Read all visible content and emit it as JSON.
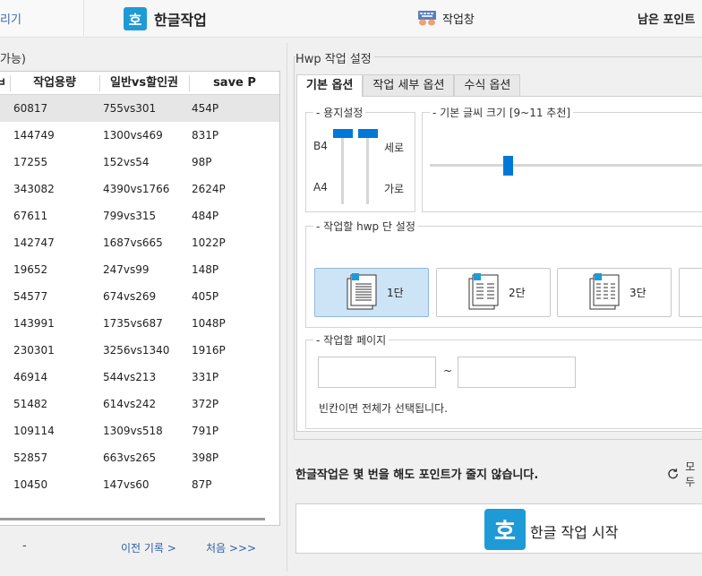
{
  "topbar": {
    "prev_label": "리기",
    "hancom_logo": "호",
    "hancom_tab": "한글작업",
    "work_tab": "작업창",
    "work_icon": "keyboard-hands-icon",
    "points": "남은 포인트"
  },
  "left": {
    "caption": "가능)",
    "headers": [
      "ㅂ",
      "작업용량",
      "일반vs할인권",
      "save P"
    ],
    "rows": [
      {
        "size": "60817",
        "ratio": "755vs301",
        "save": "454P"
      },
      {
        "size": "144749",
        "ratio": "1300vs469",
        "save": "831P"
      },
      {
        "size": "17255",
        "ratio": "152vs54",
        "save": "98P"
      },
      {
        "size": "343082",
        "ratio": "4390vs1766",
        "save": "2624P"
      },
      {
        "size": "67611",
        "ratio": "799vs315",
        "save": "484P"
      },
      {
        "size": "142747",
        "ratio": "1687vs665",
        "save": "1022P"
      },
      {
        "size": "19652",
        "ratio": "247vs99",
        "save": "148P"
      },
      {
        "size": "54577",
        "ratio": "674vs269",
        "save": "405P"
      },
      {
        "size": "143991",
        "ratio": "1735vs687",
        "save": "1048P"
      },
      {
        "size": "230301",
        "ratio": "3256vs1340",
        "save": "1916P"
      },
      {
        "size": "46914",
        "ratio": "544vs213",
        "save": "331P"
      },
      {
        "size": "51482",
        "ratio": "614vs242",
        "save": "372P"
      },
      {
        "size": "109114",
        "ratio": "1309vs518",
        "save": "791P"
      },
      {
        "size": "52857",
        "ratio": "663vs265",
        "save": "398P"
      },
      {
        "size": "10450",
        "ratio": "147vs60",
        "save": "87P"
      }
    ],
    "pager_dash": "-",
    "pager_prev": "이전 기록 >",
    "pager_first": "처음 >>>"
  },
  "settings": {
    "title": "Hwp 작업 설정",
    "tabs": [
      "기본 옵션",
      "작업 세부 옵션",
      "수식 옵션"
    ],
    "paper": {
      "title": "용지설정",
      "b4": "B4",
      "a4": "A4",
      "portrait": "세로",
      "landscape": "가로"
    },
    "font": {
      "title": "기본 글씨 크기 [9~11 추천]"
    },
    "columns": {
      "title": "작업할 hwp 단 설정",
      "options": [
        "1단",
        "2단",
        "3단"
      ],
      "selected": "1단"
    },
    "pages": {
      "title": "작업할 페이지",
      "from_value": "",
      "to_value": "",
      "tilde": "~",
      "hint": "빈칸이면 전체가 선택됩니다."
    }
  },
  "notice": "한글작업은 몇 번을 해도 포인트가 줄지 않습니다.",
  "refresh_label": "모두",
  "start": {
    "logo": "호",
    "label": "한글 작업 시작"
  },
  "colors": {
    "accent": "#0078d7",
    "hancom_blue": "#1e9bd7",
    "selected_bg": "#cde4f7",
    "link": "#2f5fa8"
  }
}
